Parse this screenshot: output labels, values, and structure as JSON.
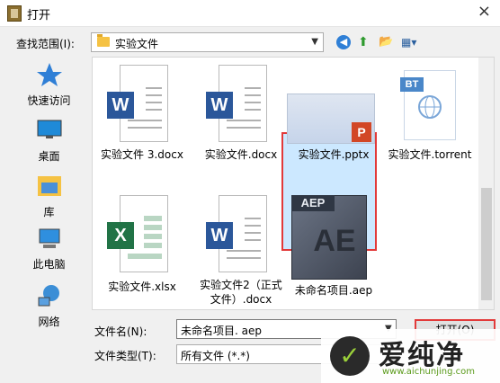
{
  "window": {
    "title": "打开"
  },
  "lookin": {
    "label": "查找范围(I):",
    "value": "实验文件"
  },
  "places": [
    {
      "label": "快速访问",
      "icon": "star-icon"
    },
    {
      "label": "桌面",
      "icon": "desktop-icon"
    },
    {
      "label": "库",
      "icon": "library-icon"
    },
    {
      "label": "此电脑",
      "icon": "computer-icon"
    },
    {
      "label": "网络",
      "icon": "network-icon"
    }
  ],
  "files": [
    {
      "name": "实验文件 3.docx",
      "type": "word"
    },
    {
      "name": "实验文件.docx",
      "type": "word"
    },
    {
      "name": "实验文件.pptx",
      "type": "ppt"
    },
    {
      "name": "实验文件.torrent",
      "type": "torrent"
    },
    {
      "name": "实验文件.xlsx",
      "type": "excel"
    },
    {
      "name": "实验文件2（正式文件）.docx",
      "name_line1": "实验文件2（正式",
      "name_line2": "文件）.docx",
      "type": "word"
    },
    {
      "name": "未命名项目.aep",
      "type": "aep",
      "selected": true
    }
  ],
  "badges": {
    "word": "W",
    "excel": "X",
    "ppt": "P",
    "torrent": "BT",
    "aep_top": "AEP",
    "aep_main": "AE"
  },
  "filename": {
    "label": "文件名(N):",
    "value": "未命名项目. aep"
  },
  "filetype": {
    "label": "文件类型(T):",
    "value": "所有文件 (*.*)"
  },
  "open_button": "打开(O)",
  "watermark": {
    "text": "爱纯净",
    "url": "www.aichunjing.com"
  },
  "colors": {
    "word": "#2b579a",
    "excel": "#217346",
    "ppt": "#d24726",
    "selection": "#cce8ff",
    "highlight": "#e23a3a"
  }
}
